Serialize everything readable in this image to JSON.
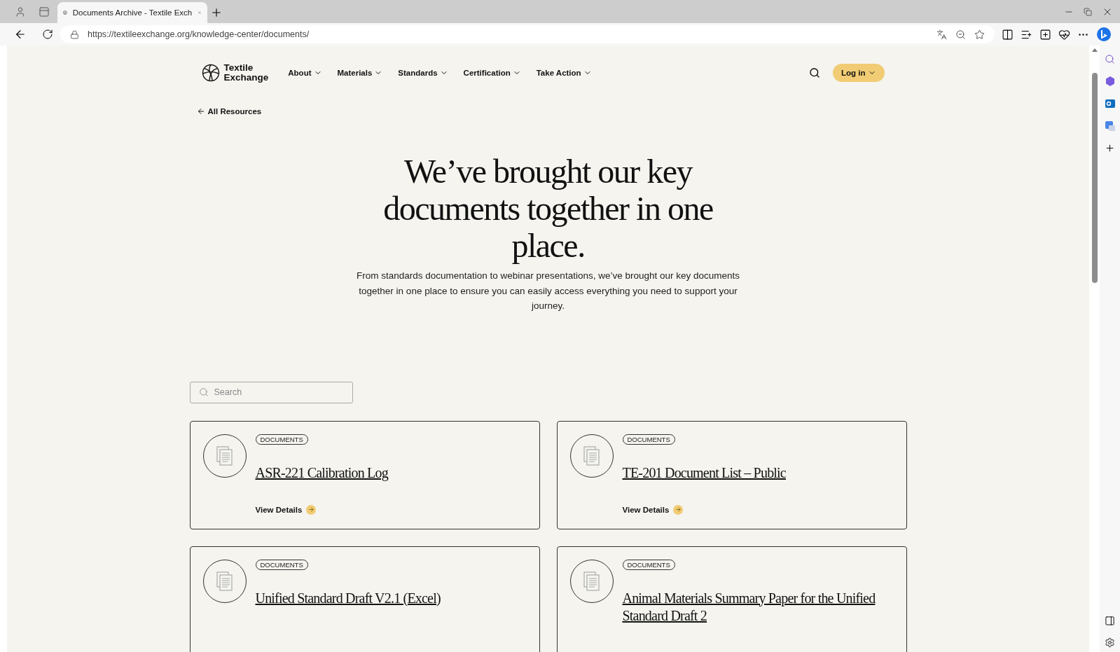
{
  "browser": {
    "tab_title": "Documents Archive - Textile Exch",
    "url": "https://textileexchange.org/knowledge-center/documents/"
  },
  "header": {
    "logo_lines": [
      "Textile",
      "Exchange"
    ],
    "nav": [
      {
        "label": "About"
      },
      {
        "label": "Materials"
      },
      {
        "label": "Standards"
      },
      {
        "label": "Certification"
      },
      {
        "label": "Take Action"
      }
    ],
    "login": "Log in"
  },
  "back_link": "All Resources",
  "hero": {
    "title": "We’ve brought our key documents together in one place.",
    "text": "From standards documentation to webinar presentations, we’ve brought our key documents together in one place to ensure you can easily access everything you need to support your journey."
  },
  "search": {
    "placeholder": "Search"
  },
  "cards": [
    {
      "tag": "DOCUMENTS",
      "title": "ASR-221 Calibration Log",
      "link": "View Details"
    },
    {
      "tag": "DOCUMENTS",
      "title": "TE-201 Document List – Public",
      "link": "View Details"
    },
    {
      "tag": "DOCUMENTS",
      "title": "Unified Standard Draft V2.1 (Excel)"
    },
    {
      "tag": "DOCUMENTS",
      "title": "Animal Materials Summary Paper for the Unified Standard Draft 2"
    }
  ]
}
